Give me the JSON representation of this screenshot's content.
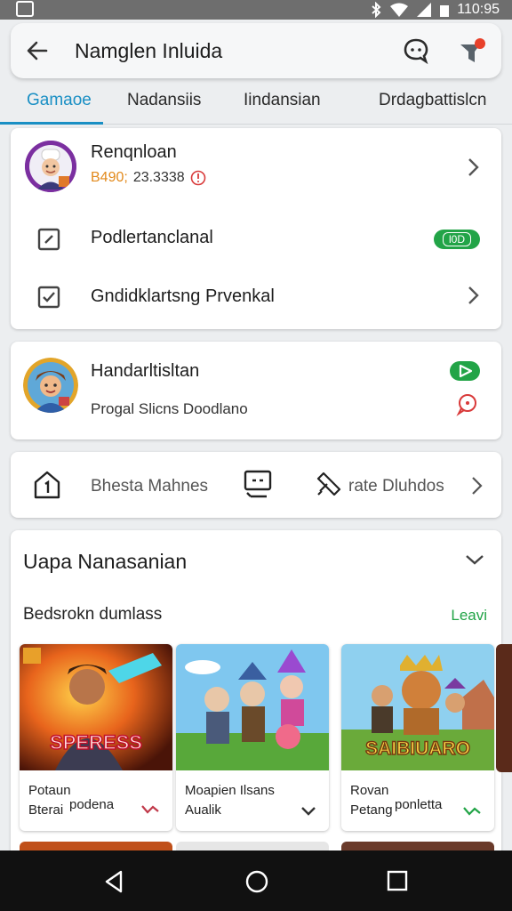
{
  "status_bar": {
    "time": "110:95"
  },
  "app_bar": {
    "title": "Namglen Inluida"
  },
  "tabs": [
    {
      "label": "Gamaое",
      "active": true
    },
    {
      "label": "Nadansiis",
      "active": false
    },
    {
      "label": "Iindansian",
      "active": false
    },
    {
      "label": "Drdagbattislcn",
      "active": false
    }
  ],
  "profile_card": {
    "name": "Renqnloan",
    "stat_prefix": "B490;",
    "stat_value": "23.3338",
    "row1_label": "Podlertanclanal",
    "row1_badge": "l0D",
    "row2_label": "Gndidklartsng Prvenkal"
  },
  "second_card": {
    "title": "Handarltisltan",
    "subtitle": "Progal Slicns Doodlano"
  },
  "quick_actions": {
    "item1": "Bhesta Mahnes",
    "item3": "rate Dluhdos"
  },
  "section": {
    "title": "Uapa Nanasanian",
    "subheading": "Bedsrokn dumlass",
    "link": "Leavi"
  },
  "games": [
    {
      "image_text": "SPERESS",
      "line1": "Potaun",
      "line2": "Bterai",
      "side": "podena"
    },
    {
      "line1": "Moapien Ilsans",
      "line2": "Aualik"
    },
    {
      "image_text": "SAIBIUARO",
      "line1": "Rovan",
      "line2": "Petang",
      "side": "ponletta"
    }
  ],
  "colors": {
    "accent": "#1a8fc4",
    "green": "#22a447",
    "red": "#d93a3a",
    "stat_orange": "#e2891b"
  },
  "icons": [
    "back-arrow-icon",
    "chat-icon",
    "notification-icon",
    "edit-icon",
    "checkbox-icon",
    "chevron-right-icon",
    "chevron-down-icon"
  ]
}
